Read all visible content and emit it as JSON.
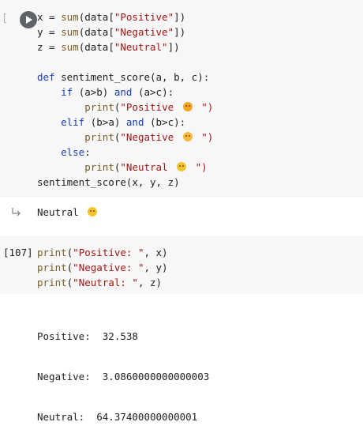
{
  "cell1": {
    "bracket": "[",
    "lines": {
      "l1": "x = sum(data[\"Positive\"])",
      "l2": "y = sum(data[\"Negative\"])",
      "l3": "z = sum(data[\"Neutral\"])",
      "l5": "def sentiment_score(a, b, c):",
      "l6": "    if (a>b) and (a>c):",
      "l7": "        print(\"Positive ",
      "l7b": " \")",
      "l8": "    elif (b>a) and (b>c):",
      "l9": "        print(\"Negative ",
      "l9b": " \")",
      "l10": "    else:",
      "l11": "        print(\"Neutral ",
      "l11b": " \")",
      "l12": "sentiment_score(x, y, z)"
    },
    "output": "Neutral "
  },
  "cell2": {
    "exec_count": "[107]",
    "lines": {
      "l1": "print(\"Positive: \", x)",
      "l2": "print(\"Negative: \", y)",
      "l3": "print(\"Neutral: \", z)"
    },
    "output": {
      "o1": "Positive:  32.538",
      "o2": "Negative:  3.0860000000000003",
      "o3": "Neutral:  64.37400000000001"
    }
  },
  "icons": {
    "run": "play-icon",
    "output": "output-arrow-icon",
    "emoji_positive": "smiling-face-icon",
    "emoji_negative": "angry-face-icon",
    "emoji_neutral": "neutral-face-icon"
  }
}
